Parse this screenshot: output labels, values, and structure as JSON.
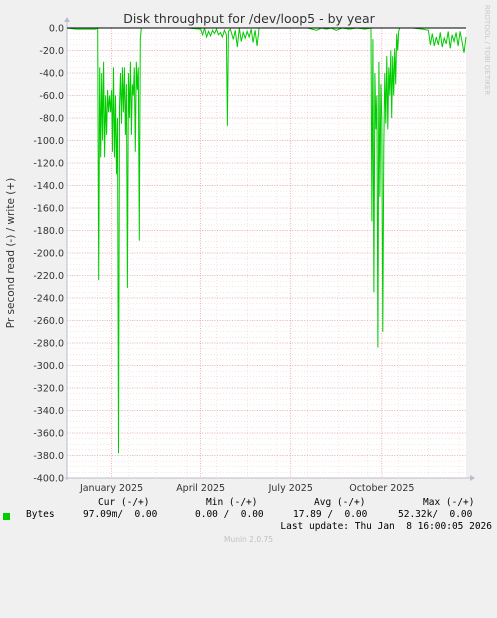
{
  "chart_data": {
    "type": "line",
    "title": "Disk throughput for /dev/loop5 - by year",
    "ylabel": "Pr second read (-) / write (+)",
    "watermark": "RRDTOOL / TOBI OETIKER",
    "ylim": [
      -400,
      0
    ],
    "yticks": [
      "0.0",
      "-20.0",
      "-40.0",
      "-60.0",
      "-80.0",
      "-100.0",
      "-120.0",
      "-140.0",
      "-160.0",
      "-180.0",
      "-200.0",
      "-220.0",
      "-240.0",
      "-260.0",
      "-280.0",
      "-300.0",
      "-320.0",
      "-340.0",
      "-360.0",
      "-380.0",
      "-400.0"
    ],
    "xlim": [
      "2024-12-01",
      "2026-01-08"
    ],
    "xticks": [
      {
        "label": "January 2025",
        "date": "2025-01-15"
      },
      {
        "label": "April 2025",
        "date": "2025-04-15"
      },
      {
        "label": "July 2025",
        "date": "2025-07-15"
      },
      {
        "label": "October 2025",
        "date": "2025-10-15"
      }
    ],
    "grid": true,
    "series": [
      {
        "name": "Bytes",
        "color": "#00cc00",
        "points": [
          [
            "2024-12-01",
            0
          ],
          [
            "2024-12-10",
            -1
          ],
          [
            "2024-12-20",
            -1
          ],
          [
            "2024-12-30",
            -1
          ],
          [
            "2025-01-01",
            0
          ],
          [
            "2025-01-02",
            -224
          ],
          [
            "2025-01-03",
            -35
          ],
          [
            "2025-01-04",
            -115
          ],
          [
            "2025-01-05",
            -40
          ],
          [
            "2025-01-06",
            -100
          ],
          [
            "2025-01-07",
            -30
          ],
          [
            "2025-01-08",
            -115
          ],
          [
            "2025-01-09",
            -60
          ],
          [
            "2025-01-10",
            -95
          ],
          [
            "2025-01-11",
            -55
          ],
          [
            "2025-01-12",
            -75
          ],
          [
            "2025-01-13",
            -60
          ],
          [
            "2025-01-14",
            -75
          ],
          [
            "2025-01-15",
            -55
          ],
          [
            "2025-01-16",
            -110
          ],
          [
            "2025-01-17",
            -35
          ],
          [
            "2025-01-18",
            -115
          ],
          [
            "2025-01-19",
            -60
          ],
          [
            "2025-01-20",
            -130
          ],
          [
            "2025-01-21",
            -80
          ],
          [
            "2025-01-22",
            -378
          ],
          [
            "2025-01-23",
            -70
          ],
          [
            "2025-01-24",
            -40
          ],
          [
            "2025-01-25",
            -85
          ],
          [
            "2025-01-26",
            -35
          ],
          [
            "2025-01-27",
            -75
          ],
          [
            "2025-01-28",
            -35
          ],
          [
            "2025-01-29",
            -95
          ],
          [
            "2025-01-30",
            -50
          ],
          [
            "2025-01-31",
            -231
          ],
          [
            "2025-02-01",
            -40
          ],
          [
            "2025-02-02",
            -80
          ],
          [
            "2025-02-03",
            -30
          ],
          [
            "2025-02-04",
            -95
          ],
          [
            "2025-02-05",
            -50
          ],
          [
            "2025-02-06",
            -60
          ],
          [
            "2025-02-07",
            -35
          ],
          [
            "2025-02-08",
            -110
          ],
          [
            "2025-02-09",
            -30
          ],
          [
            "2025-02-10",
            -55
          ],
          [
            "2025-02-11",
            -35
          ],
          [
            "2025-02-12",
            -189
          ],
          [
            "2025-02-13",
            -10
          ],
          [
            "2025-02-14",
            0
          ],
          [
            "2025-03-01",
            0
          ],
          [
            "2025-04-01",
            0
          ],
          [
            "2025-04-15",
            -1
          ],
          [
            "2025-04-17",
            -6
          ],
          [
            "2025-04-19",
            0
          ],
          [
            "2025-04-21",
            -8
          ],
          [
            "2025-04-23",
            -3
          ],
          [
            "2025-04-25",
            -7
          ],
          [
            "2025-04-27",
            -2
          ],
          [
            "2025-04-29",
            -5
          ],
          [
            "2025-05-01",
            -1
          ],
          [
            "2025-05-03",
            -6
          ],
          [
            "2025-05-05",
            -4
          ],
          [
            "2025-05-07",
            -8
          ],
          [
            "2025-05-09",
            -2
          ],
          [
            "2025-05-11",
            -6
          ],
          [
            "2025-05-12",
            -87
          ],
          [
            "2025-05-13",
            -3
          ],
          [
            "2025-05-15",
            -1
          ],
          [
            "2025-05-18",
            -10
          ],
          [
            "2025-05-20",
            -2
          ],
          [
            "2025-05-22",
            -17
          ],
          [
            "2025-05-24",
            0
          ],
          [
            "2025-05-26",
            -12
          ],
          [
            "2025-05-28",
            -4
          ],
          [
            "2025-05-30",
            -9
          ],
          [
            "2025-06-01",
            -3
          ],
          [
            "2025-06-03",
            -8
          ],
          [
            "2025-06-05",
            -1
          ],
          [
            "2025-06-07",
            -13
          ],
          [
            "2025-06-09",
            -2
          ],
          [
            "2025-06-11",
            -16
          ],
          [
            "2025-06-13",
            0
          ],
          [
            "2025-06-15",
            0
          ],
          [
            "2025-07-01",
            0
          ],
          [
            "2025-08-01",
            0
          ],
          [
            "2025-08-10",
            -2
          ],
          [
            "2025-08-15",
            0
          ],
          [
            "2025-08-20",
            -1
          ],
          [
            "2025-08-25",
            0
          ],
          [
            "2025-08-30",
            -2
          ],
          [
            "2025-09-05",
            0
          ],
          [
            "2025-09-12",
            -1
          ],
          [
            "2025-09-20",
            0
          ],
          [
            "2025-09-28",
            -1
          ],
          [
            "2025-10-04",
            0
          ],
          [
            "2025-10-05",
            -172
          ],
          [
            "2025-10-06",
            -10
          ],
          [
            "2025-10-07",
            -235
          ],
          [
            "2025-10-08",
            -40
          ],
          [
            "2025-10-09",
            -90
          ],
          [
            "2025-10-10",
            -60
          ],
          [
            "2025-10-11",
            -284
          ],
          [
            "2025-10-12",
            -30
          ],
          [
            "2025-10-13",
            -150
          ],
          [
            "2025-10-14",
            -50
          ],
          [
            "2025-10-15",
            -80
          ],
          [
            "2025-10-16",
            -270
          ],
          [
            "2025-10-17",
            -107
          ],
          [
            "2025-10-18",
            -40
          ],
          [
            "2025-10-19",
            -85
          ],
          [
            "2025-10-20",
            -25
          ],
          [
            "2025-10-21",
            -90
          ],
          [
            "2025-10-22",
            -35
          ],
          [
            "2025-10-23",
            -60
          ],
          [
            "2025-10-24",
            -20
          ],
          [
            "2025-10-25",
            -80
          ],
          [
            "2025-10-26",
            -25
          ],
          [
            "2025-10-27",
            -60
          ],
          [
            "2025-10-28",
            -18
          ],
          [
            "2025-10-29",
            -50
          ],
          [
            "2025-10-30",
            -5
          ],
          [
            "2025-10-31",
            -20
          ],
          [
            "2025-11-01",
            -3
          ],
          [
            "2025-11-02",
            0
          ],
          [
            "2025-11-15",
            0
          ],
          [
            "2025-11-25",
            -1
          ],
          [
            "2025-12-01",
            -2
          ],
          [
            "2025-12-03",
            -15
          ],
          [
            "2025-12-05",
            -5
          ],
          [
            "2025-12-07",
            -16
          ],
          [
            "2025-12-09",
            -8
          ],
          [
            "2025-12-11",
            -15
          ],
          [
            "2025-12-13",
            -4
          ],
          [
            "2025-12-15",
            -17
          ],
          [
            "2025-12-17",
            -9
          ],
          [
            "2025-12-19",
            -14
          ],
          [
            "2025-12-21",
            -3
          ],
          [
            "2025-12-23",
            -18
          ],
          [
            "2025-12-25",
            -6
          ],
          [
            "2025-12-27",
            -12
          ],
          [
            "2025-12-29",
            -4
          ],
          [
            "2025-12-31",
            -16
          ],
          [
            "2026-01-02",
            -3
          ],
          [
            "2026-01-04",
            -12
          ],
          [
            "2026-01-06",
            -22
          ],
          [
            "2026-01-08",
            -8
          ]
        ]
      }
    ]
  },
  "legend": {
    "headers": {
      "cur": "Cur (-/+)",
      "min": "Min (-/+)",
      "avg": "Avg (-/+)",
      "max": "Max (-/+)"
    },
    "series_label": "Bytes",
    "cur": "97.09m/  0.00",
    "min": "0.00 /  0.00",
    "avg": "17.89 /  0.00",
    "max": "52.32k/  0.00"
  },
  "last_update": "Last update: Thu Jan  8 16:00:05 2026",
  "footer": "Munin 2.0.75"
}
